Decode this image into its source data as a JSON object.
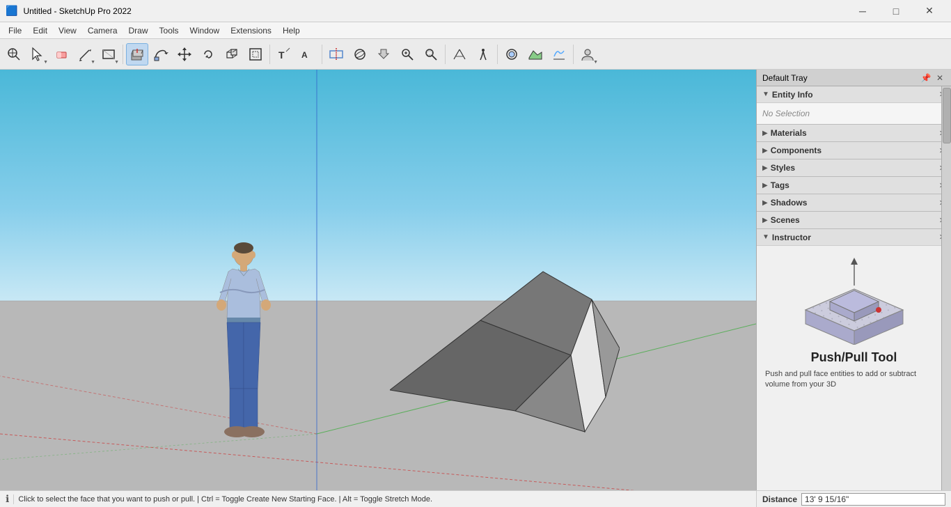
{
  "app": {
    "title": "Untitled - SketchUp Pro 2022",
    "icon": "su-icon"
  },
  "titlebar": {
    "title": "Untitled - SketchUp Pro 2022",
    "minimize": "─",
    "maximize": "□",
    "close": "✕"
  },
  "menubar": {
    "items": [
      "File",
      "Edit",
      "View",
      "Camera",
      "Draw",
      "Tools",
      "Window",
      "Extensions",
      "Help"
    ]
  },
  "toolbar": {
    "tools": [
      {
        "name": "zoom-extents",
        "icon": "🔍",
        "has_arrow": false,
        "active": false
      },
      {
        "name": "select",
        "icon": "↖",
        "has_arrow": true,
        "active": false
      },
      {
        "name": "eraser",
        "icon": "◻",
        "has_arrow": false,
        "active": false
      },
      {
        "name": "pencil",
        "icon": "✏",
        "has_arrow": true,
        "active": false
      },
      {
        "name": "shape",
        "icon": "⬡",
        "has_arrow": true,
        "active": false
      },
      {
        "name": "push-pull",
        "icon": "⬛",
        "has_arrow": false,
        "active": true
      },
      {
        "name": "follow-me",
        "icon": "↻",
        "has_arrow": false,
        "active": false
      },
      {
        "name": "move",
        "icon": "✛",
        "has_arrow": false,
        "active": false
      },
      {
        "name": "rotate",
        "icon": "↺",
        "has_arrow": false,
        "active": false
      },
      {
        "name": "scale",
        "icon": "⤢",
        "has_arrow": false,
        "active": false
      },
      {
        "name": "offset",
        "icon": "⬜",
        "has_arrow": false,
        "active": false
      },
      {
        "name": "text",
        "icon": "T",
        "has_arrow": false,
        "active": false
      },
      {
        "name": "3d-text",
        "icon": "A",
        "has_arrow": false,
        "active": false
      },
      {
        "name": "dimension",
        "icon": "⇔",
        "has_arrow": false,
        "active": false
      },
      {
        "name": "section-plane",
        "icon": "⊕",
        "has_arrow": false,
        "active": false
      },
      {
        "name": "orbit",
        "icon": "⊕",
        "has_arrow": false,
        "active": false
      },
      {
        "name": "pan",
        "icon": "✋",
        "has_arrow": false,
        "active": false
      },
      {
        "name": "zoom",
        "icon": "🔎",
        "has_arrow": false,
        "active": false
      },
      {
        "name": "zoom-window",
        "icon": "⊞",
        "has_arrow": false,
        "active": false
      },
      {
        "name": "field-of-view",
        "icon": "⬙",
        "has_arrow": false,
        "active": false
      },
      {
        "name": "walk",
        "icon": "🚶",
        "has_arrow": false,
        "active": false
      },
      {
        "name": "toolbar-styles",
        "icon": "◎",
        "has_arrow": false,
        "active": false
      },
      {
        "name": "account",
        "icon": "👤",
        "has_arrow": true,
        "active": false
      }
    ]
  },
  "right_panel": {
    "default_tray_label": "Default Tray",
    "entity_info": {
      "title": "Entity Info",
      "status": "No Selection"
    },
    "sections": [
      {
        "name": "Materials",
        "title": "Materials"
      },
      {
        "name": "Components",
        "title": "Components"
      },
      {
        "name": "Styles",
        "title": "Styles"
      },
      {
        "name": "Tags",
        "title": "Tags"
      },
      {
        "name": "Shadows",
        "title": "Shadows"
      },
      {
        "name": "Scenes",
        "title": "Scenes"
      },
      {
        "name": "Instructor",
        "title": "Instructor"
      }
    ],
    "instructor": {
      "tool_name": "Push/Pull Tool",
      "description": "Push and pull face entities to add or subtract volume from your 3D"
    }
  },
  "statusbar": {
    "info_icon": "ℹ",
    "message": "Click to select the face that you want to push or pull. | Ctrl = Toggle Create New Starting Face. | Alt = Toggle Stretch Mode.",
    "distance_label": "Distance",
    "distance_value": "13' 9 15/16\""
  }
}
